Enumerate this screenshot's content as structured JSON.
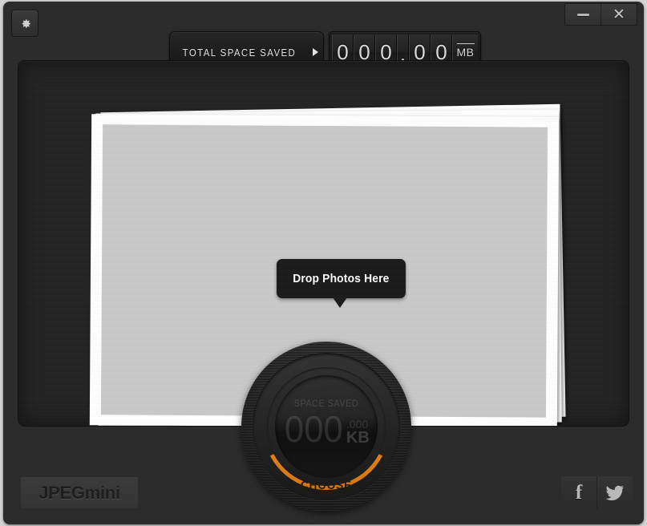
{
  "window": {
    "controls": {
      "minimize_label": "—",
      "close_label": "✕"
    },
    "settings_icon": "gear-icon"
  },
  "toolbar": {
    "total_space_saved_label": "TOTAL SPACE SAVED",
    "arrow_icon": "triangle-right-icon",
    "counter": {
      "digits": [
        "0",
        "0",
        "0",
        ".",
        "0",
        "0"
      ],
      "unit": "MB",
      "value_text": "000.00"
    }
  },
  "drop_area": {
    "tooltip_text": "Drop Photos Here",
    "photo_count": 3
  },
  "dial": {
    "label": "SPACE SAVED",
    "value": "000",
    "fraction": ".000",
    "unit": "KB",
    "choose_label": "CHOOSE",
    "accent_color": "#e8861a"
  },
  "footer": {
    "brand": "JPEGmini",
    "social": [
      {
        "name": "facebook",
        "glyph": "f"
      },
      {
        "name": "twitter",
        "glyph": "twitter-bird-icon"
      }
    ]
  },
  "colors": {
    "desktop_bg": "#d4d4d4",
    "window_bg": "#2b2b2b",
    "panel_bg": "#232323",
    "photo_white": "#ffffff",
    "photo_fill": "#c9c9c9",
    "accent_orange": "#e8861a",
    "text_light": "#e2e2e2"
  }
}
